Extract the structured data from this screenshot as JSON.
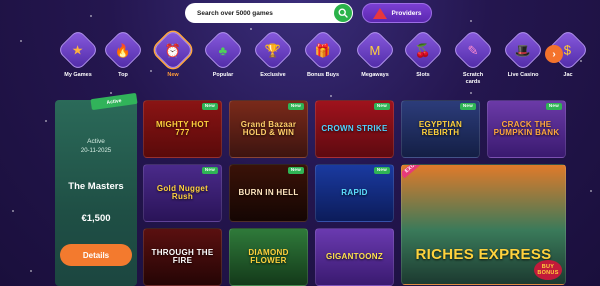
{
  "search": {
    "placeholder": "Search over 5000 games"
  },
  "providers": {
    "label": "Providers"
  },
  "categories": [
    {
      "label": "My Games",
      "icon": "star-icon",
      "glyph": "★",
      "color": "#ffb23d"
    },
    {
      "label": "Top",
      "icon": "flame-icon",
      "glyph": "🔥",
      "color": "#ff6a2a"
    },
    {
      "label": "New",
      "icon": "clock-icon",
      "glyph": "⏰",
      "color": "#ffae3a"
    },
    {
      "label": "Popular",
      "icon": "clover-icon",
      "glyph": "♣",
      "color": "#4ed05a"
    },
    {
      "label": "Exclusive",
      "icon": "trophy-icon",
      "glyph": "🏆",
      "color": "#ffc43d"
    },
    {
      "label": "Bonus Buys",
      "icon": "gift-icon",
      "glyph": "🎁",
      "color": "#ff5a7a"
    },
    {
      "label": "Megaways",
      "icon": "m-letter-icon",
      "glyph": "M",
      "color": "#ffcf3d"
    },
    {
      "label": "Slots",
      "icon": "cherries-icon",
      "glyph": "🍒",
      "color": "#e8373d"
    },
    {
      "label": "Scratch cards",
      "icon": "scratch-card-icon",
      "glyph": "✎",
      "color": "#ff8ad0"
    },
    {
      "label": "Live Casino",
      "icon": "dealer-icon",
      "glyph": "🎩",
      "color": "#ffd23d"
    },
    {
      "label": "Jac",
      "icon": "jackpot-icon",
      "glyph": "$",
      "color": "#ffcc33"
    }
  ],
  "active_category": "New",
  "tournament": {
    "ribbon": "Active",
    "status": "Active",
    "date": "20-11-2025",
    "name": "The Masters",
    "prize": "€1,500",
    "button": "Details"
  },
  "games": [
    {
      "title": "MIGHTY HOT 777",
      "badge": "New",
      "bg": "linear-gradient(#8a1414,#5a0a0a)",
      "color": "#ffd23d"
    },
    {
      "title": "Grand Bazaar HOLD & WIN",
      "badge": "New",
      "bg": "linear-gradient(#7a2a1a,#3d1410)",
      "color": "#ffcf6a"
    },
    {
      "title": "CROWN STRIKE",
      "badge": "New",
      "bg": "linear-gradient(#a0121c,#5e0a10)",
      "color": "#4fd3ff"
    },
    {
      "title": "EGYPTIAN REBIRTH",
      "badge": "New",
      "bg": "linear-gradient(#2c3c7a,#141f45)",
      "color": "#ffd23d"
    },
    {
      "title": "CRACK THE PUMPKIN BANK",
      "badge": "New",
      "bg": "linear-gradient(#6b3aa8,#3a1a70)",
      "color": "#ffa83d"
    },
    {
      "title": "Gold Nugget Rush",
      "badge": "New",
      "bg": "linear-gradient(#4a2a8a,#2a1458)",
      "color": "#ffd23d"
    },
    {
      "title": "BURN IN HELL",
      "badge": "New",
      "bg": "linear-gradient(#3a1208,#150603)",
      "color": "#ffe6c0"
    },
    {
      "title": "RAPID",
      "badge": "New",
      "bg": "linear-gradient(#1a3aa0,#0c1c5a)",
      "color": "#5fe0ff"
    },
    {
      "title": "RICHES EXPRESS",
      "badge": "",
      "bg": "linear-gradient(#e07a2a,#3a7a5a 55%,#1c3a30)",
      "color": "#ffd23d"
    },
    {
      "title": "THROUGH THE FIRE",
      "badge": "",
      "bg": "linear-gradient(#5a1010,#250505)",
      "color": "#ffffff"
    },
    {
      "title": "DIAMOND FLOWER",
      "badge": "",
      "bg": "linear-gradient(#2f7a3a,#143a1a)",
      "color": "#ffd23d"
    },
    {
      "title": "GIGANTOONZ",
      "badge": "",
      "bg": "linear-gradient(#6a3ab0,#3a1a70)",
      "color": "#ffe24d"
    }
  ],
  "big_game_extras": {
    "exclusive": "EXCLUSIVE",
    "buy_bonus": "BUY BONUS"
  }
}
